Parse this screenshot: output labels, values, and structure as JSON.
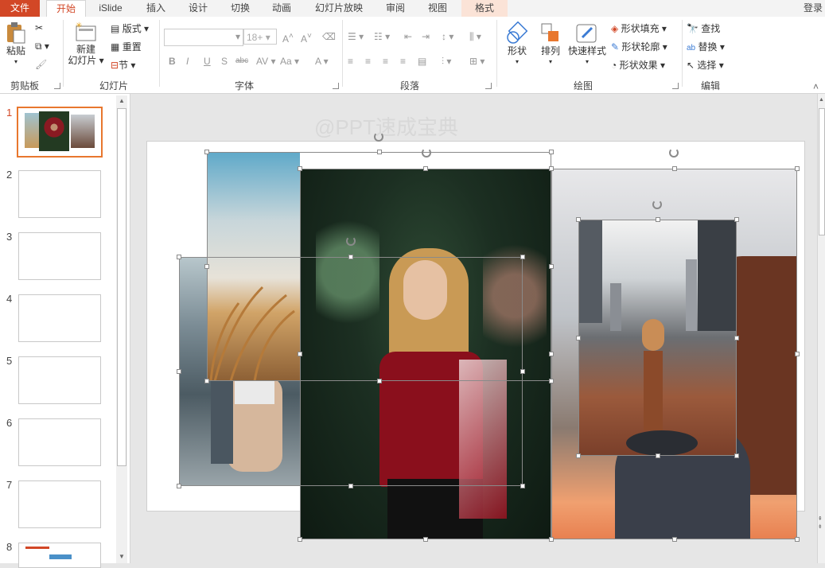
{
  "tabs": {
    "file": "文件",
    "home": "开始",
    "islide": "iSlide",
    "insert": "插入",
    "design": "设计",
    "transitions": "切换",
    "animations": "动画",
    "slideshow": "幻灯片放映",
    "review": "审阅",
    "view": "视图",
    "format": "格式",
    "login": "登录"
  },
  "ribbon": {
    "clipboard": {
      "paste": "粘贴",
      "label": "剪贴板"
    },
    "slides": {
      "new_slide_line1": "新建",
      "new_slide_line2": "幻灯片",
      "layout": "版式",
      "reset": "重置",
      "section": "节",
      "label": "幻灯片"
    },
    "font": {
      "size": "18+",
      "label": "字体"
    },
    "paragraph": {
      "label": "段落"
    },
    "drawing": {
      "shapes": "形状",
      "arrange": "排列",
      "quick_styles": "快速样式",
      "fill": "形状填充",
      "outline": "形状轮廓",
      "effects": "形状效果",
      "label": "绘图"
    },
    "editing": {
      "find": "查找",
      "replace": "替换",
      "select": "选择",
      "label": "编辑"
    }
  },
  "thumbnails": {
    "numbers": [
      "1",
      "2",
      "3",
      "4",
      "5",
      "6",
      "7",
      "8"
    ]
  },
  "watermark": "@PPT速成宝典",
  "colors": {
    "accent": "#d24726",
    "ribbon_bg": "#ffffff",
    "tabbar_bg": "#f3f3f3"
  }
}
